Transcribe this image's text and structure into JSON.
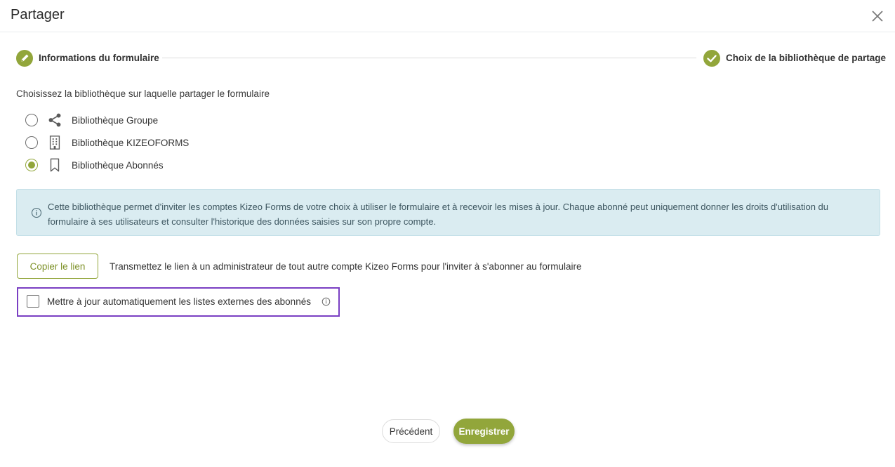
{
  "dialog": {
    "title": "Partager",
    "close_icon": "close-icon"
  },
  "stepper": {
    "steps": [
      {
        "label": "Informations du formulaire",
        "icon": "pencil-icon",
        "state": "done"
      },
      {
        "label": "Choix de la bibliothèque de partage",
        "icon": "check-icon",
        "state": "active"
      }
    ]
  },
  "library": {
    "prompt": "Choisissez la bibliothèque sur laquelle partager le formulaire",
    "options": [
      {
        "label": "Bibliothèque Groupe",
        "icon": "share-icon",
        "selected": false
      },
      {
        "label": "Bibliothèque KIZEOFORMS",
        "icon": "building-icon",
        "selected": false
      },
      {
        "label": "Bibliothèque Abonnés",
        "icon": "bookmark-icon",
        "selected": true
      }
    ]
  },
  "info": {
    "text": "Cette bibliothèque permet d'inviter les comptes Kizeo Forms de votre choix à utiliser le formulaire et à recevoir les mises à jour. Chaque abonné peut uniquement donner les droits d'utilisation du formulaire à ses utilisateurs et consulter l'historique des données saisies sur son propre compte."
  },
  "copy_link": {
    "button_label": "Copier le lien",
    "description": "Transmettez le lien à un administrateur de tout autre compte Kizeo Forms pour l'inviter à s'abonner au formulaire"
  },
  "auto_update": {
    "label": "Mettre à jour automatiquement les listes externes des abonnés",
    "checked": false
  },
  "footer": {
    "previous_label": "Précédent",
    "save_label": "Enregistrer"
  },
  "colors": {
    "accent": "#92a63b",
    "info_bg": "#daecf1",
    "highlight": "#7a3fc3"
  }
}
